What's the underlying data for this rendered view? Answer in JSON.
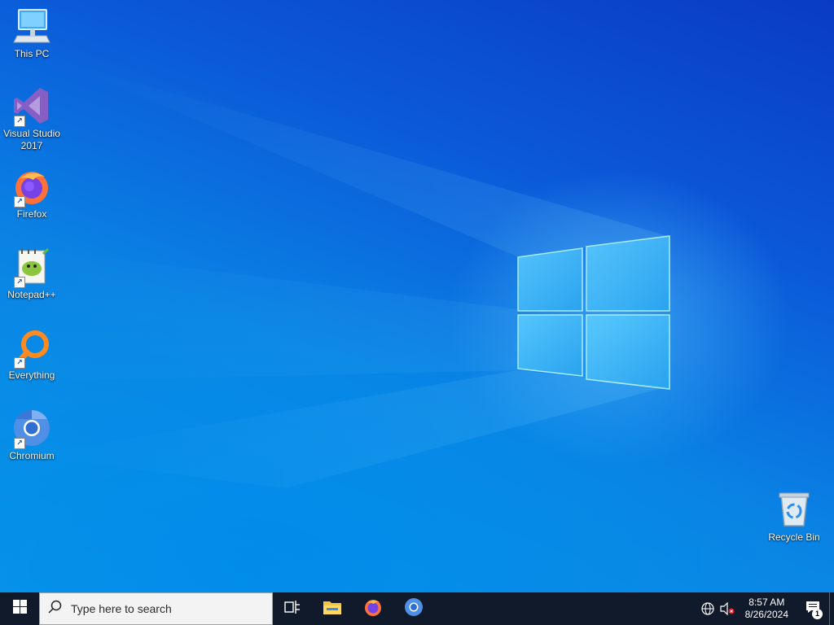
{
  "desktop": {
    "icons": [
      {
        "name": "This PC",
        "icon": "this-pc-icon"
      },
      {
        "name": "Visual Studio 2017",
        "icon": "visual-studio-icon",
        "shortcut": true
      },
      {
        "name": "Firefox",
        "icon": "firefox-icon",
        "shortcut": true
      },
      {
        "name": "Notepad++",
        "icon": "notepad-plus-plus-icon",
        "shortcut": true
      },
      {
        "name": "Everything",
        "icon": "everything-icon",
        "shortcut": true
      },
      {
        "name": "Chromium",
        "icon": "chromium-icon",
        "shortcut": true
      }
    ],
    "recycle_bin": {
      "name": "Recycle Bin",
      "icon": "recycle-bin-icon"
    },
    "wallpaper": {
      "accent": "#0a78e0",
      "glow": "#5ac8ff"
    }
  },
  "taskbar": {
    "start": {
      "icon": "windows-logo-icon"
    },
    "search": {
      "placeholder": "Type here to search",
      "icon": "search-icon"
    },
    "task_view": {
      "icon": "task-view-icon"
    },
    "apps": [
      {
        "name": "File Explorer",
        "icon": "file-explorer-icon"
      },
      {
        "name": "Firefox",
        "icon": "firefox-icon"
      },
      {
        "name": "Chromium",
        "icon": "chromium-icon"
      }
    ],
    "tray": {
      "network_icon": "network-globe-icon",
      "volume_icon": "volume-muted-icon",
      "time": "8:57 AM",
      "date": "8/26/2024",
      "notification_count": "1",
      "notification_icon": "notification-center-icon"
    },
    "background": "#101a2b"
  }
}
